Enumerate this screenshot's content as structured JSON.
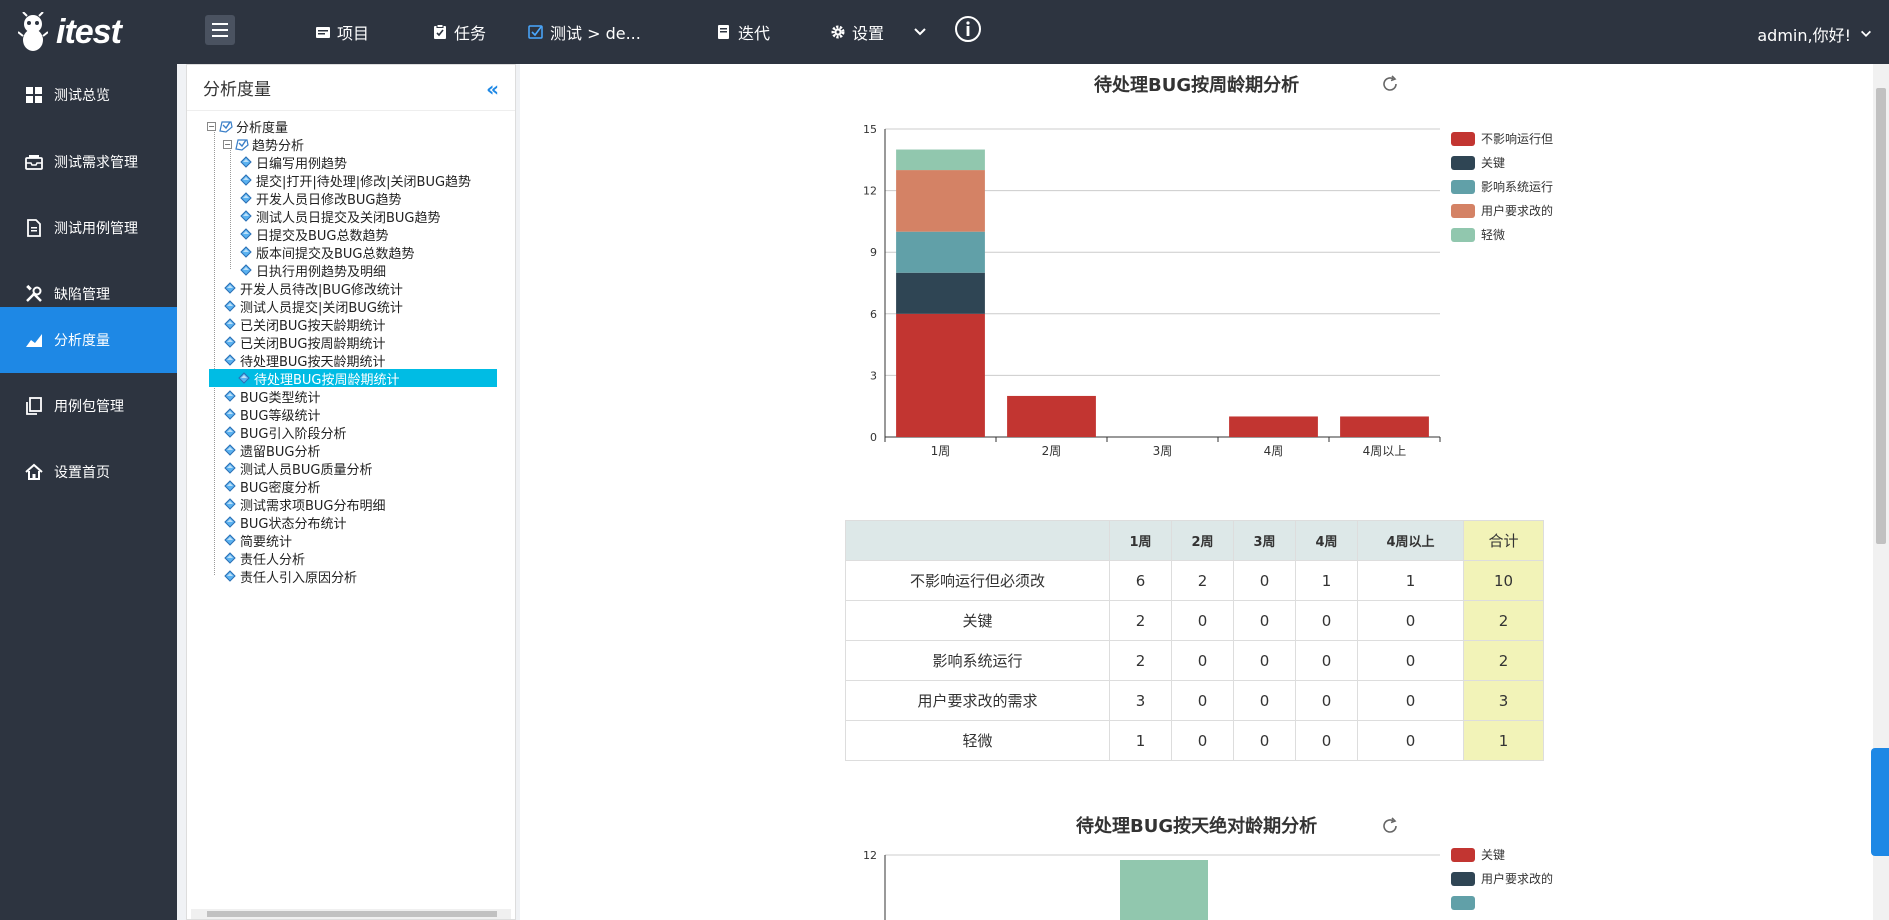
{
  "app": {
    "logo_text": "itest"
  },
  "topnav": {
    "items": [
      {
        "label": "项目"
      },
      {
        "label": "任务"
      },
      {
        "label": "测试 > de..."
      },
      {
        "label": "迭代"
      },
      {
        "label": "设置"
      }
    ],
    "user_label": "admin,你好!"
  },
  "sidebar": {
    "items": [
      {
        "label": "测试总览"
      },
      {
        "label": "测试需求管理"
      },
      {
        "label": "测试用例管理"
      },
      {
        "label": "缺陷管理"
      },
      {
        "label": "分析度量"
      },
      {
        "label": "用例包管理"
      },
      {
        "label": "设置首页"
      }
    ],
    "active_index": 4
  },
  "tree_panel": {
    "title": "分析度量",
    "nodes": [
      {
        "label": "分析度量"
      },
      {
        "label": "趋势分析"
      },
      {
        "label": "日编写用例趋势"
      },
      {
        "label": "提交|打开|待处理|修改|关闭BUG趋势"
      },
      {
        "label": "开发人员日修改BUG趋势"
      },
      {
        "label": "测试人员日提交及关闭BUG趋势"
      },
      {
        "label": "日提交及BUG总数趋势"
      },
      {
        "label": "版本间提交及BUG总数趋势"
      },
      {
        "label": "日执行用例趋势及明细"
      },
      {
        "label": "开发人员待改|BUG修改统计"
      },
      {
        "label": "测试人员提交|关闭BUG统计"
      },
      {
        "label": "已关闭BUG按天龄期统计"
      },
      {
        "label": "已关闭BUG按周龄期统计"
      },
      {
        "label": "待处理BUG按天龄期统计"
      },
      {
        "label": "待处理BUG按周龄期统计"
      },
      {
        "label": "BUG类型统计"
      },
      {
        "label": "BUG等级统计"
      },
      {
        "label": "BUG引入阶段分析"
      },
      {
        "label": "遗留BUG分析"
      },
      {
        "label": "测试人员BUG质量分析"
      },
      {
        "label": "BUG密度分析"
      },
      {
        "label": "测试需求项BUG分布明细"
      },
      {
        "label": "BUG状态分布统计"
      },
      {
        "label": "简要统计"
      },
      {
        "label": "责任人分析"
      },
      {
        "label": "责任人引入原因分析"
      }
    ],
    "selected_index": 14
  },
  "chart_data": [
    {
      "type": "bar",
      "stacked": true,
      "title": "待处理BUG按周龄期分析",
      "categories": [
        "1周",
        "2周",
        "3周",
        "4周",
        "4周以上"
      ],
      "series": [
        {
          "name": "不影响运行但必须改",
          "legend_label": "不影响运行但",
          "color": "#c23531",
          "values": [
            6,
            2,
            0,
            1,
            1
          ]
        },
        {
          "name": "关键",
          "legend_label": "关键",
          "color": "#2f4554",
          "values": [
            2,
            0,
            0,
            0,
            0
          ]
        },
        {
          "name": "影响系统运行",
          "legend_label": "影响系统运行",
          "color": "#61a0a8",
          "values": [
            2,
            0,
            0,
            0,
            0
          ]
        },
        {
          "name": "用户要求改的需求",
          "legend_label": "用户要求改的",
          "color": "#d48265",
          "values": [
            3,
            0,
            0,
            0,
            0
          ]
        },
        {
          "name": "轻微",
          "legend_label": "轻微",
          "color": "#91c7ae",
          "values": [
            1,
            0,
            0,
            0,
            0
          ]
        }
      ],
      "yticks": [
        "0",
        "3",
        "6",
        "9",
        "12",
        "15"
      ],
      "ylim": [
        0,
        15
      ],
      "grid": true,
      "legend_position": "right"
    },
    {
      "type": "bar",
      "stacked": true,
      "title": "待处理BUG按天绝对龄期分析",
      "legend": [
        {
          "label": "关键",
          "color": "#c23531"
        },
        {
          "label": "用户要求改的",
          "color": "#2f4554"
        },
        {
          "label": "",
          "color": "#61a0a8"
        }
      ],
      "yticks": [
        "12"
      ],
      "grid": true,
      "legend_position": "right"
    }
  ],
  "table": {
    "headers": [
      "",
      "1周",
      "2周",
      "3周",
      "4周",
      "4周以上",
      "合计"
    ],
    "rows": [
      [
        "不影响运行但必须改",
        "6",
        "2",
        "0",
        "1",
        "1",
        "10"
      ],
      [
        "关键",
        "2",
        "0",
        "0",
        "0",
        "0",
        "2"
      ],
      [
        "影响系统运行",
        "2",
        "0",
        "0",
        "0",
        "0",
        "2"
      ],
      [
        "用户要求改的需求",
        "3",
        "0",
        "0",
        "0",
        "0",
        "3"
      ],
      [
        "轻微",
        "1",
        "0",
        "0",
        "0",
        "0",
        "1"
      ]
    ]
  }
}
